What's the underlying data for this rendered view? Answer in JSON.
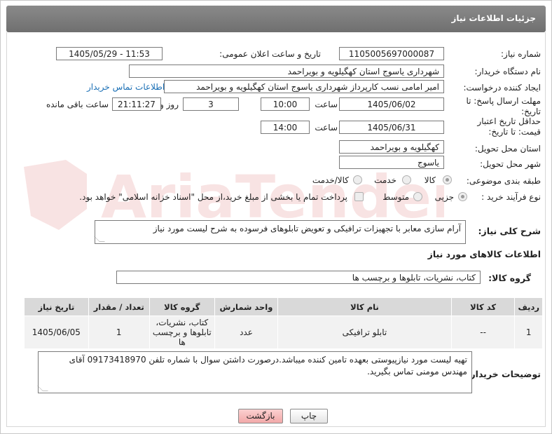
{
  "header": {
    "title": "جزئیات اطلاعات نیاز"
  },
  "labels": {
    "need_number": "شماره نیاز:",
    "announce_datetime": "تاریخ و ساعت اعلان عمومی:",
    "buyer_org": "نام دستگاه خریدار:",
    "requester": "ایجاد کننده درخواست:",
    "reply_deadline": "مهلت ارسال پاسخ: تا تاریخ:",
    "time": "ساعت",
    "day_and": "روز و",
    "time_remaining": "ساعت باقی مانده",
    "price_validity": "حداقل تاریخ اعتبار قیمت: تا تاریخ:",
    "delivery_province": "استان محل تحویل:",
    "delivery_city": "شهر محل تحویل:",
    "category": "طبقه بندی موضوعی:",
    "purchase_type": "نوع فرآیند خرید :",
    "general_desc": "شرح کلی نیاز:",
    "goods_info": "اطلاعات کالاهای مورد نیاز",
    "goods_group": "گروه کالا:",
    "buyer_notes": "توضیحات خریدار:"
  },
  "values": {
    "need_number": "1105005697000087",
    "announce_datetime": "1405/05/29 - 11:53",
    "buyer_org": "شهرداری یاسوج استان کهگیلویه و بویراحمد",
    "requester": "امیر امامی نسب کارپرداز شهرداری یاسوج استان کهگیلویه و بویراحمد",
    "buyer_contact_link": "اطلاعات تماس خریدار",
    "reply_date": "1405/06/02",
    "reply_time": "10:00",
    "days_left": "3",
    "time_left": "21:11:27",
    "price_date": "1405/06/31",
    "price_time": "14:00",
    "delivery_province": "کهگیلویه و بویراحمد",
    "delivery_city": "یاسوج",
    "general_desc": "آرام سازی معابر با تجهیزات ترافیکی و تعویض تابلوهای فرسوده به شرح لیست مورد نیاز",
    "goods_group": "کتاب، نشریات، تابلوها و برچسب ها",
    "buyer_notes": "تهیه لیست مورد نیازپیوستی بعهده تامین کننده میباشد.درصورت داشتن سوال با شماره تلفن 09173418970 آقای مهندس مومنی تماس بگیرید."
  },
  "category_options": {
    "goods": "کالا",
    "service": "خدمت",
    "goods_service": "کالا/خدمت",
    "selected": "goods"
  },
  "purchase_options": {
    "minor": "جزیی",
    "medium": "متوسط",
    "selected": "minor",
    "treasury_note": "پرداخت تمام یا بخشی از مبلغ خرید،از محل \"اسناد خزانه اسلامی\" خواهد بود."
  },
  "table": {
    "headers": [
      "ردیف",
      "کد کالا",
      "نام کالا",
      "واحد شمارش",
      "گروه کالا",
      "تعداد / مقدار",
      "تاریخ نیاز"
    ],
    "rows": [
      [
        "1",
        "--",
        "تابلو ترافیکی",
        "عدد",
        "کتاب، نشریات، تابلوها و برچسب ها",
        "1",
        "1405/06/05"
      ]
    ]
  },
  "buttons": {
    "print": "چاپ",
    "back": "بازگشت"
  },
  "watermark": {
    "text": "AriaTender.neT"
  },
  "colors": {
    "link": "#1a6fb5",
    "back_button": "#f7b9b9",
    "title_bar": "#7a7a7a"
  }
}
